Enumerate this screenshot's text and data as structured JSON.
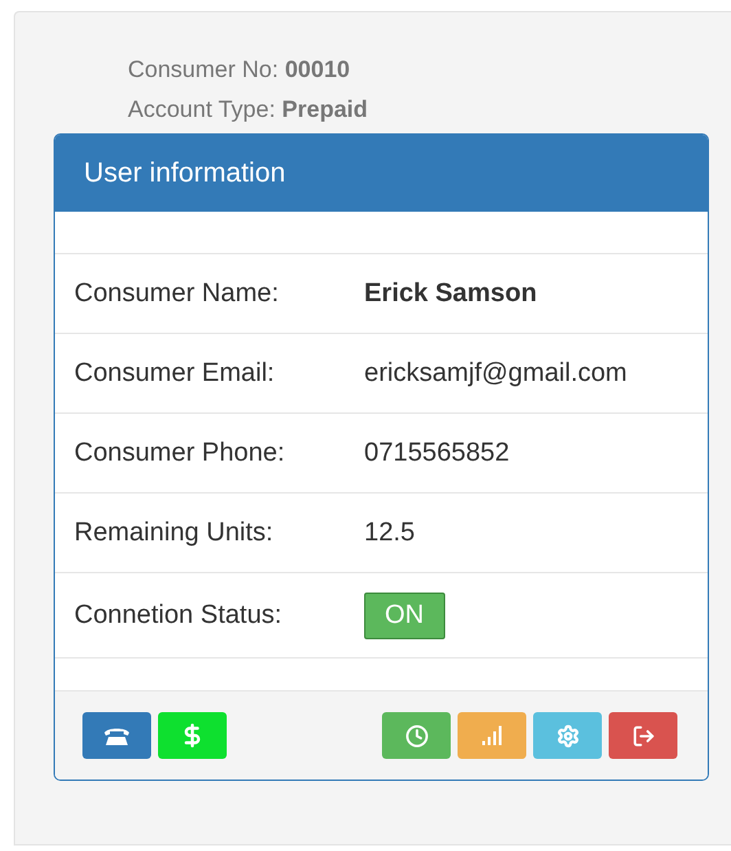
{
  "account": [
    {
      "label": "Consumer No:",
      "value": "00010"
    },
    {
      "label": "Account Type:",
      "value": "Prepaid"
    }
  ],
  "card": {
    "title": "User information",
    "rows": [
      {
        "kind": "text",
        "label": "Consumer Name:",
        "value": "Erick Samson",
        "bold": true
      },
      {
        "kind": "text",
        "label": "Consumer Email:",
        "value": "ericksamjf@gmail.com",
        "bold": false
      },
      {
        "kind": "text",
        "label": "Consumer Phone:",
        "value": "0715565852",
        "bold": false
      },
      {
        "kind": "text",
        "label": "Remaining Units:",
        "value": "12.5",
        "bold": false
      },
      {
        "kind": "status",
        "label": "Connetion Status:",
        "value": "ON",
        "on": true
      }
    ],
    "left_buttons": [
      {
        "kind": "phone",
        "color": "#337ab7"
      },
      {
        "kind": "dollar",
        "color": "#0ee02f"
      }
    ],
    "right_buttons": [
      {
        "kind": "clock",
        "color": "#5cb85c"
      },
      {
        "kind": "signal",
        "color": "#f0ad4e"
      },
      {
        "kind": "gear",
        "color": "#5bc0de"
      },
      {
        "kind": "logout",
        "color": "#d9534f"
      }
    ]
  }
}
